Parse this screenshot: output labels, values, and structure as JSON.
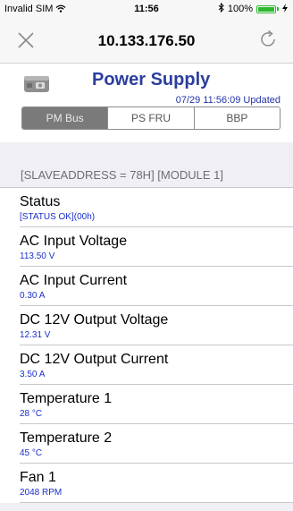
{
  "status_bar": {
    "carrier": "Invalid SIM",
    "wifi_icon": "wifi-icon",
    "time": "11:56",
    "bluetooth_icon": "bluetooth-icon",
    "battery": "100%",
    "battery_level": 1.0
  },
  "nav": {
    "title": "10.133.176.50",
    "close_icon": "close-icon",
    "refresh_icon": "refresh-icon"
  },
  "header": {
    "icon": "power-supply-icon",
    "title": "Power Supply",
    "updated": "07/29 11:56:09 Updated"
  },
  "tabs": [
    {
      "label": "PM Bus",
      "active": true
    },
    {
      "label": "PS FRU",
      "active": false
    },
    {
      "label": "BBP",
      "active": false
    }
  ],
  "section_header": "[SLAVEADDRESS = 78H] [MODULE 1]",
  "items": [
    {
      "label": "Status",
      "value": "[STATUS OK](00h)"
    },
    {
      "label": "AC Input Voltage",
      "value": "113.50 V"
    },
    {
      "label": "AC Input Current",
      "value": "0.30 A"
    },
    {
      "label": "DC 12V Output Voltage",
      "value": "12.31 V"
    },
    {
      "label": "DC 12V Output Current",
      "value": "3.50 A"
    },
    {
      "label": "Temperature 1",
      "value": "28 °C"
    },
    {
      "label": "Temperature 2",
      "value": "45 °C"
    },
    {
      "label": "Fan 1",
      "value": "2048 RPM"
    }
  ],
  "colors": {
    "accent_blue": "#2b3e9e",
    "value_blue": "#1a2fcc",
    "battery_green": "#2eb82e",
    "tab_active": "#7a7a7a"
  }
}
